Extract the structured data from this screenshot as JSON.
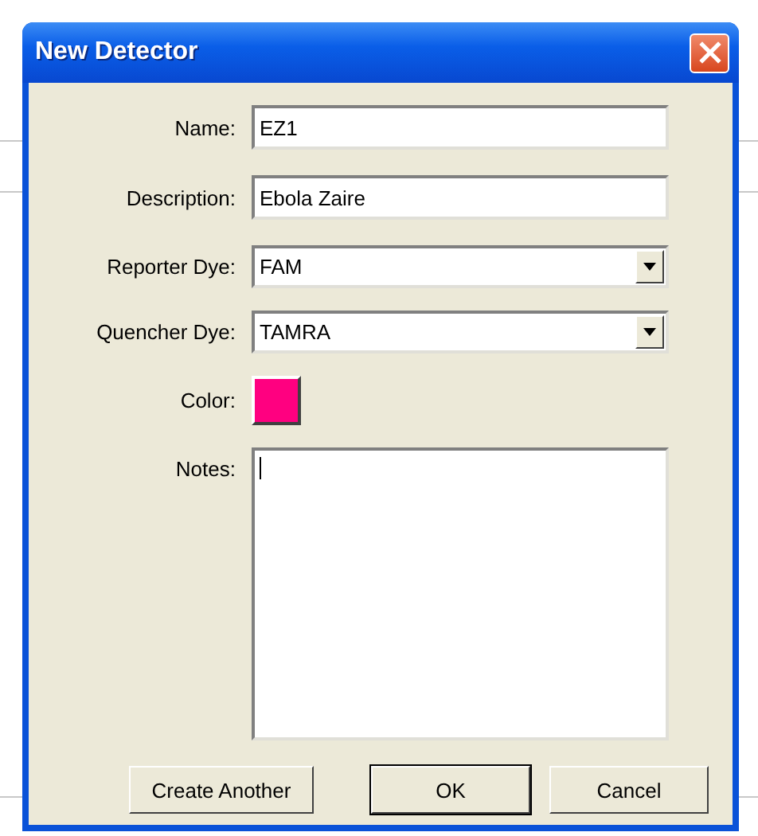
{
  "window": {
    "title": "New Detector"
  },
  "fields": [
    {
      "kind": "text",
      "label": "Name:",
      "value": "EZ1"
    },
    {
      "kind": "text",
      "label": "Description:",
      "value": "Ebola Zaire"
    },
    {
      "kind": "dropdown",
      "label": "Reporter Dye:",
      "value": "FAM"
    },
    {
      "kind": "dropdown",
      "label": "Quencher Dye:",
      "value": "TAMRA"
    },
    {
      "kind": "color",
      "label": "Color:",
      "color": "#ff0080"
    },
    {
      "kind": "notes",
      "label": "Notes:",
      "focused": true
    }
  ],
  "buttons": [
    {
      "label": "Create Another",
      "default": false
    },
    {
      "label": "OK",
      "default": true
    },
    {
      "label": "Cancel",
      "default": false
    }
  ]
}
